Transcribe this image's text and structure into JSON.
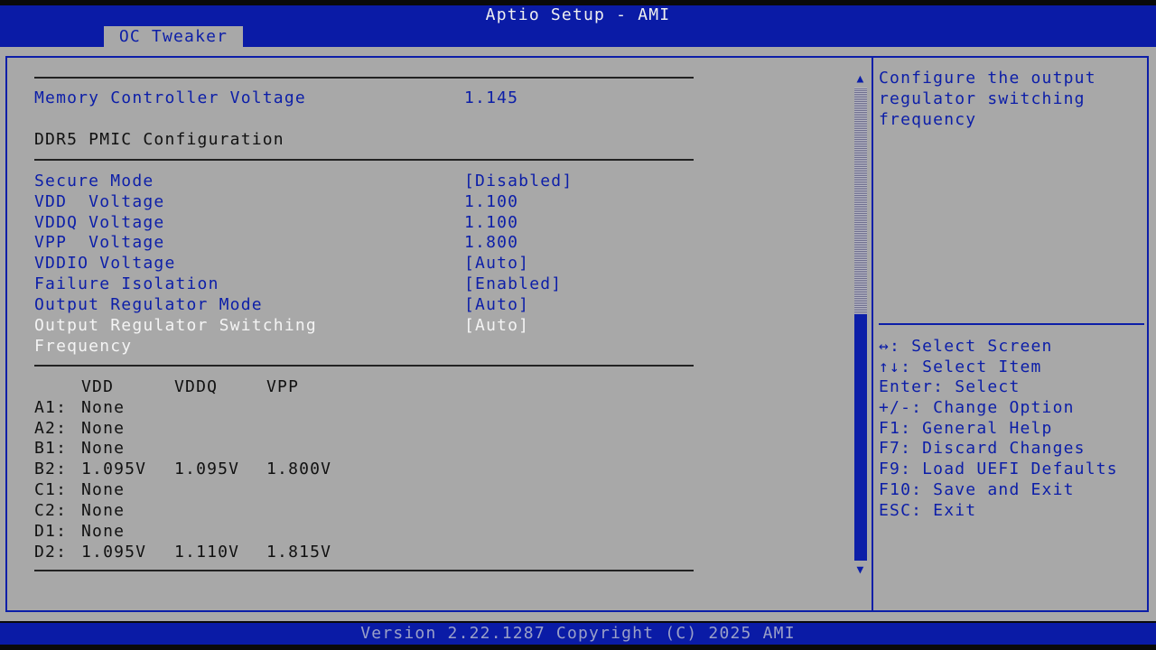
{
  "header": {
    "title": "Aptio Setup - AMI",
    "tab": "OC Tweaker"
  },
  "settings": {
    "memory_controller_voltage": {
      "label": "Memory Controller Voltage",
      "value": "1.145"
    },
    "section_title": "DDR5 PMIC Configuration",
    "items": [
      {
        "label": "Secure Mode",
        "value": "[Disabled]"
      },
      {
        "label": "VDD  Voltage",
        "value": "1.100"
      },
      {
        "label": "VDDQ Voltage",
        "value": "1.100"
      },
      {
        "label": "VPP  Voltage",
        "value": "1.800"
      },
      {
        "label": "VDDIO Voltage",
        "value": "[Auto]"
      },
      {
        "label": "Failure Isolation",
        "value": "[Enabled]"
      },
      {
        "label": "Output Regulator Mode",
        "value": "[Auto]"
      }
    ],
    "selected_item": {
      "label_line1": "Output Regulator Switching",
      "label_line2": "Frequency",
      "value": "[Auto]"
    }
  },
  "voltage_table": {
    "headers": [
      "VDD",
      "VDDQ",
      "VPP"
    ],
    "rows": [
      {
        "slot": "A1:",
        "vdd": "None",
        "vddq": "",
        "vpp": ""
      },
      {
        "slot": "A2:",
        "vdd": "None",
        "vddq": "",
        "vpp": ""
      },
      {
        "slot": "B1:",
        "vdd": "None",
        "vddq": "",
        "vpp": ""
      },
      {
        "slot": "B2:",
        "vdd": "1.095V",
        "vddq": "1.095V",
        "vpp": "1.800V"
      },
      {
        "slot": "C1:",
        "vdd": "None",
        "vddq": "",
        "vpp": ""
      },
      {
        "slot": "C2:",
        "vdd": "None",
        "vddq": "",
        "vpp": ""
      },
      {
        "slot": "D1:",
        "vdd": "None",
        "vddq": "",
        "vpp": ""
      },
      {
        "slot": "D2:",
        "vdd": "1.095V",
        "vddq": "1.110V",
        "vpp": "1.815V"
      }
    ]
  },
  "help": {
    "description": [
      "Configure the output",
      "regulator switching",
      "frequency"
    ],
    "keys": [
      "↔: Select Screen",
      "↑↓: Select Item",
      "Enter: Select",
      "+/-: Change Option",
      "F1: General Help",
      "F7: Discard Changes",
      "F9: Load UEFI Defaults",
      "F10: Save and Exit",
      "ESC: Exit"
    ]
  },
  "scrollbar": {
    "thumb_position_percent": 48
  },
  "footer": {
    "text": "Version 2.22.1287 Copyright (C) 2025 AMI"
  },
  "colors": {
    "bios_blue": "#0c1ea8",
    "panel_gray": "#a8a8a8",
    "selected_text": "#f4f4f4"
  }
}
